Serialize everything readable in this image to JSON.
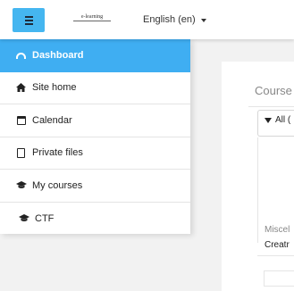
{
  "header": {
    "menu_toggle_icon": "hamburger-icon",
    "logo_text": "e-learning",
    "language_label": "English (en)",
    "accent_color": "#3faef2"
  },
  "sidebar": {
    "items": [
      {
        "label": "Dashboard",
        "icon": "dashboard-icon",
        "active": true
      },
      {
        "label": "Site home",
        "icon": "home-icon"
      },
      {
        "label": "Calendar",
        "icon": "calendar-icon"
      },
      {
        "label": "Private files",
        "icon": "file-icon"
      },
      {
        "label": "My courses",
        "icon": "graduation-cap-icon"
      },
      {
        "label": "CTF",
        "icon": "graduation-cap-icon"
      }
    ]
  },
  "main": {
    "card_title": "Course",
    "filter_label": "All (",
    "course_category": "Miscel",
    "course_name": "Creatr"
  }
}
